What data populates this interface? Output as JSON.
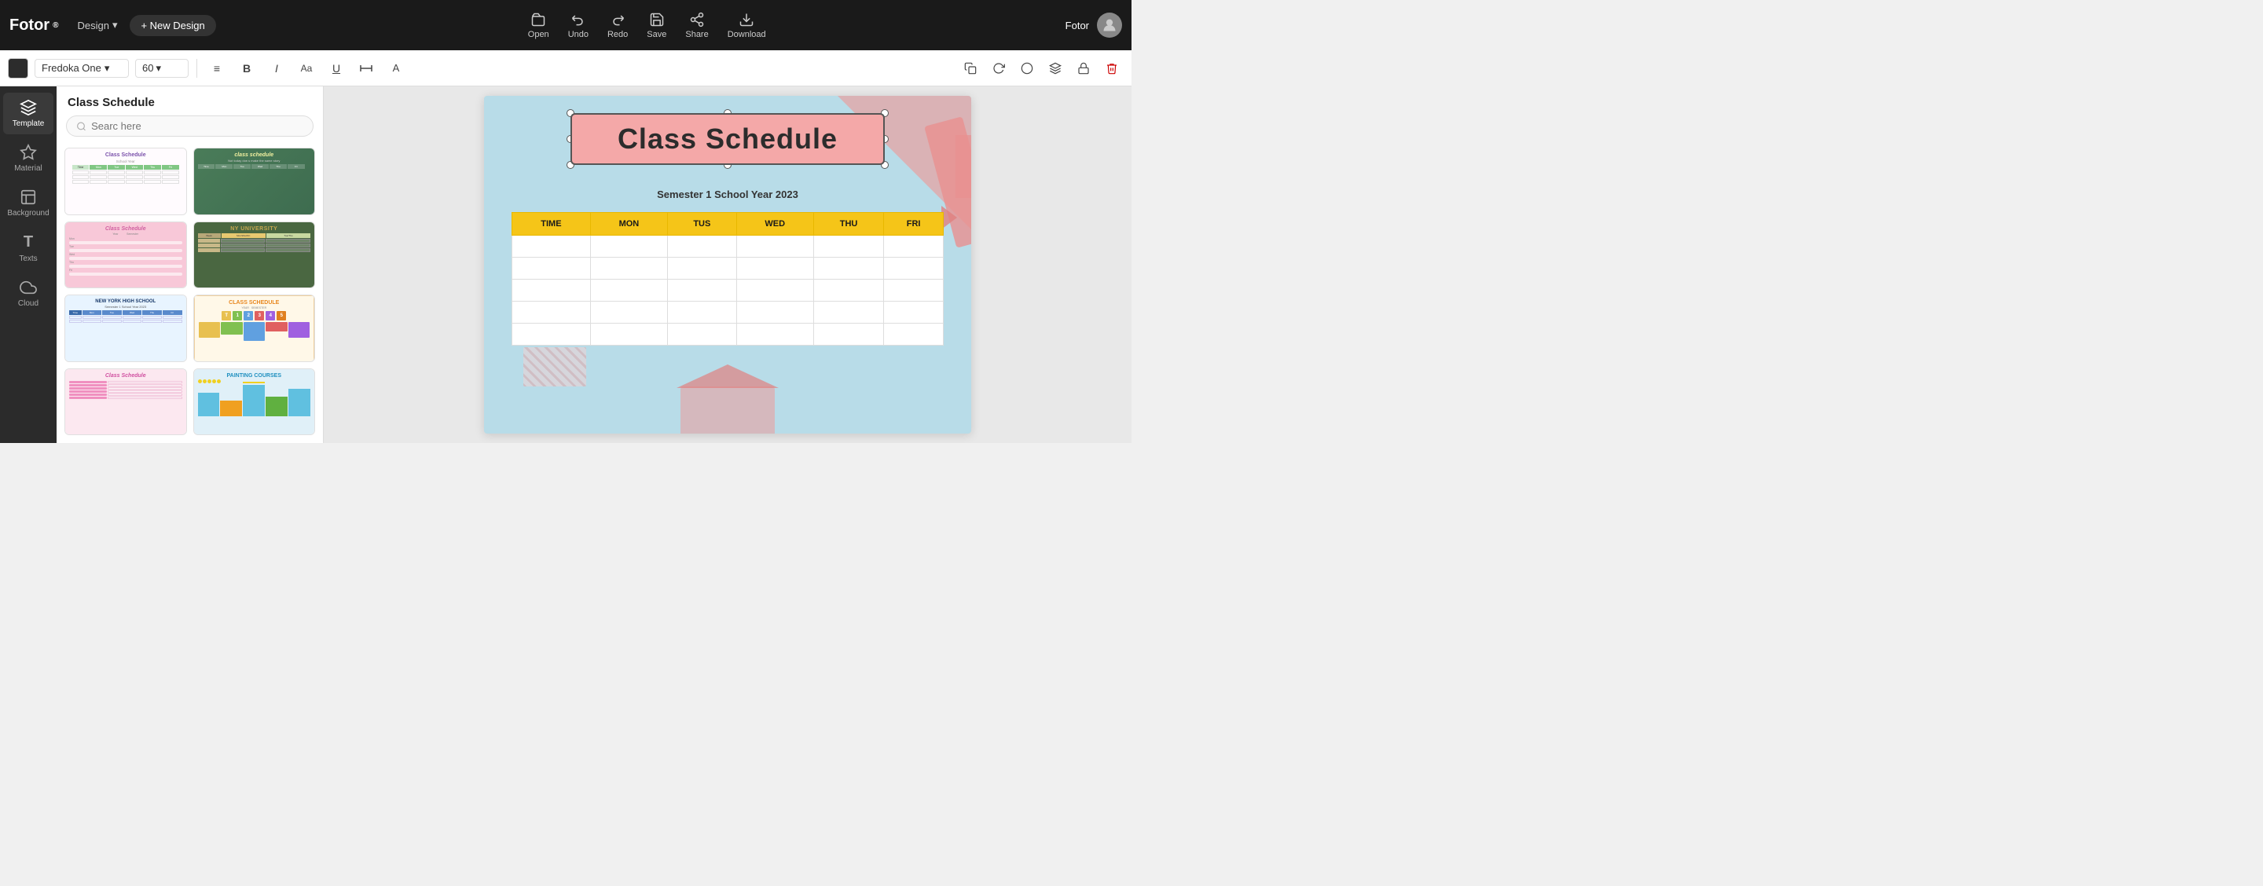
{
  "app": {
    "logo": "fotor",
    "logo_superscript": "®",
    "design_label": "Design",
    "new_design_label": "+ New Design",
    "user_name": "Fotor"
  },
  "nav_tools": [
    {
      "id": "open",
      "label": "Open",
      "icon": "open"
    },
    {
      "id": "undo",
      "label": "Undo",
      "icon": "undo"
    },
    {
      "id": "redo",
      "label": "Redo",
      "icon": "redo"
    },
    {
      "id": "save",
      "label": "Save",
      "icon": "save"
    },
    {
      "id": "share",
      "label": "Share",
      "icon": "share"
    },
    {
      "id": "download",
      "label": "Download",
      "icon": "download"
    }
  ],
  "toolbar": {
    "font_color": "#2c2c2c",
    "font_name": "Fredoka One",
    "font_size": "60",
    "tools": [
      "align",
      "bold",
      "italic",
      "font-size-alt",
      "underline",
      "letter-spacing",
      "case"
    ]
  },
  "sidebar": {
    "items": [
      {
        "id": "template",
        "label": "Template",
        "icon": "layers"
      },
      {
        "id": "material",
        "label": "Material",
        "icon": "star"
      },
      {
        "id": "background",
        "label": "Background",
        "icon": "background"
      },
      {
        "id": "texts",
        "label": "Texts",
        "icon": "T"
      },
      {
        "id": "cloud",
        "label": "Cloud",
        "icon": "cloud"
      }
    ],
    "active": "template"
  },
  "template_panel": {
    "title": "Class Schedule",
    "search_placeholder": "Searc here",
    "templates": [
      {
        "id": 1,
        "title": "Class Schedule",
        "style": "light-purple"
      },
      {
        "id": 2,
        "title": "class schedule",
        "style": "dark-floral"
      },
      {
        "id": 3,
        "title": "Class Schedule",
        "style": "pink-pastel"
      },
      {
        "id": 4,
        "title": "NY UNIVERSITY",
        "style": "green-dark"
      },
      {
        "id": 5,
        "title": "NEW YORK HIGH SCHOOL",
        "style": "blue-light"
      },
      {
        "id": 6,
        "title": "CLASS SCHEDULE",
        "style": "yellow-dino"
      },
      {
        "id": 7,
        "title": "Class Schedule",
        "style": "pink-dots"
      },
      {
        "id": 8,
        "title": "PAINTING COURSES",
        "style": "teal-chart"
      }
    ]
  },
  "canvas": {
    "title": "Class Schedule",
    "subtitle": "Semester 1 School Year 2023",
    "table": {
      "headers": [
        "TIME",
        "MON",
        "TUS",
        "WED",
        "THU",
        "FRI"
      ],
      "rows": [
        [
          "",
          "",
          "",
          "",
          "",
          ""
        ],
        [
          "",
          "",
          "",
          "",
          "",
          ""
        ],
        [
          "",
          "",
          "",
          "",
          "",
          ""
        ],
        [
          "",
          "",
          "",
          "",
          "",
          ""
        ],
        [
          "",
          "",
          "",
          "",
          "",
          ""
        ]
      ]
    }
  },
  "toolbar_right": {
    "copy_icon": "copy",
    "refresh_icon": "refresh",
    "circle_icon": "circle",
    "layers_icon": "layers",
    "lock_icon": "lock",
    "delete_icon": "delete"
  }
}
